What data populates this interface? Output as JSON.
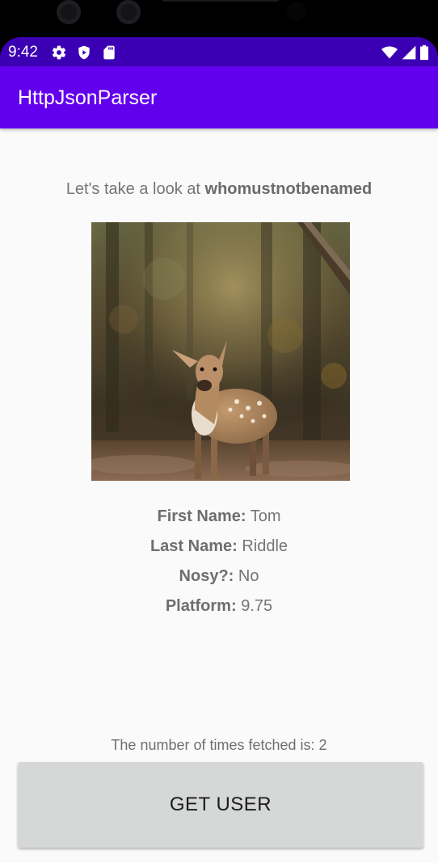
{
  "status_bar": {
    "time": "9:42",
    "left_icons": [
      "gear-icon",
      "shield-icon",
      "sd-card-icon"
    ],
    "right_icons": [
      "wifi-icon",
      "signal-icon",
      "battery-icon"
    ],
    "background": "#3c00b4"
  },
  "app_bar": {
    "title": "HttpJsonParser",
    "background": "#6200ee"
  },
  "main": {
    "intro_prefix": "Let's take a look at ",
    "username": "whomustnotbenamed",
    "profile_image": "deer-photo",
    "details": [
      {
        "label": "First Name:",
        "value": "Tom"
      },
      {
        "label": "Last Name:",
        "value": "Riddle"
      },
      {
        "label": "Nosy?:",
        "value": "No"
      },
      {
        "label": "Platform:",
        "value": "9.75"
      }
    ],
    "fetch_count_text": "The number of times fetched is: 2",
    "get_user_button": "GET USER"
  }
}
